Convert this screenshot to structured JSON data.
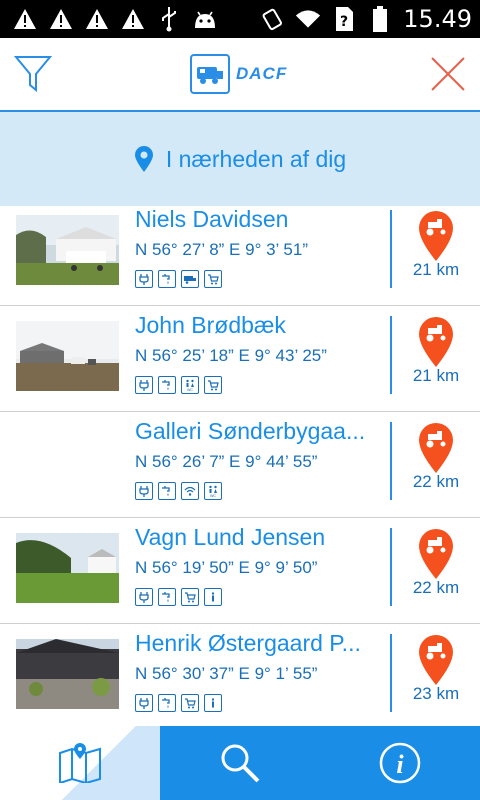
{
  "status_bar": {
    "time": "15.49",
    "left_icons": [
      "warning-icon",
      "warning-icon",
      "warning-icon",
      "warning-icon",
      "usb-icon",
      "android-icon"
    ],
    "right_icons": [
      "vibrate-icon",
      "wifi-icon",
      "sim-unknown-icon",
      "battery-icon"
    ]
  },
  "header": {
    "logo_text": "DACF",
    "filter_icon": "filter-icon",
    "close_icon": "close-icon"
  },
  "nearby": {
    "label": "I nærheden af dig",
    "icon": "location-pin-icon"
  },
  "locations": [
    {
      "name": "Niels Davidsen",
      "coords": "N 56° 27’ 8” E 9° 3’ 51”",
      "distance": "21 km",
      "amenities": [
        "power-icon",
        "water-icon",
        "caravan-icon",
        "shop-icon"
      ],
      "thumb": "farmyard-van"
    },
    {
      "name": "John Brødbæk",
      "coords": "N 56° 25’ 18” E 9° 43’ 25”",
      "distance": "21 km",
      "amenities": [
        "power-icon",
        "water-icon",
        "toilet-icon",
        "shop-icon"
      ],
      "thumb": "field-horses"
    },
    {
      "name": "Galleri Sønderbygaa...",
      "coords": "N 56° 26’ 7” E 9° 44’ 55”",
      "distance": "22 km",
      "amenities": [
        "power-icon",
        "water-icon",
        "wifi-icon",
        "toilet-icon"
      ],
      "thumb": ""
    },
    {
      "name": "Vagn Lund Jensen",
      "coords": "N 56° 19’ 50” E 9° 9’ 50”",
      "distance": "22 km",
      "amenities": [
        "power-icon",
        "water-icon",
        "shop-icon",
        "info-icon"
      ],
      "thumb": "lawn-house"
    },
    {
      "name": "Henrik Østergaard P...",
      "coords": "N 56° 30’ 37” E 9° 1’ 55”",
      "distance": "23 km",
      "amenities": [
        "power-icon",
        "water-icon",
        "shop-icon",
        "info-icon"
      ],
      "thumb": "garden-barn"
    }
  ],
  "tabs": [
    {
      "name": "map",
      "icon": "map-icon",
      "active": true
    },
    {
      "name": "search",
      "icon": "search-icon",
      "active": false
    },
    {
      "name": "info",
      "icon": "info-icon",
      "active": false
    }
  ],
  "colors": {
    "accent": "#1a8ee6",
    "nearby_bg": "#d4e9f8",
    "pin": "#f4511e",
    "close": "#e8604c"
  }
}
